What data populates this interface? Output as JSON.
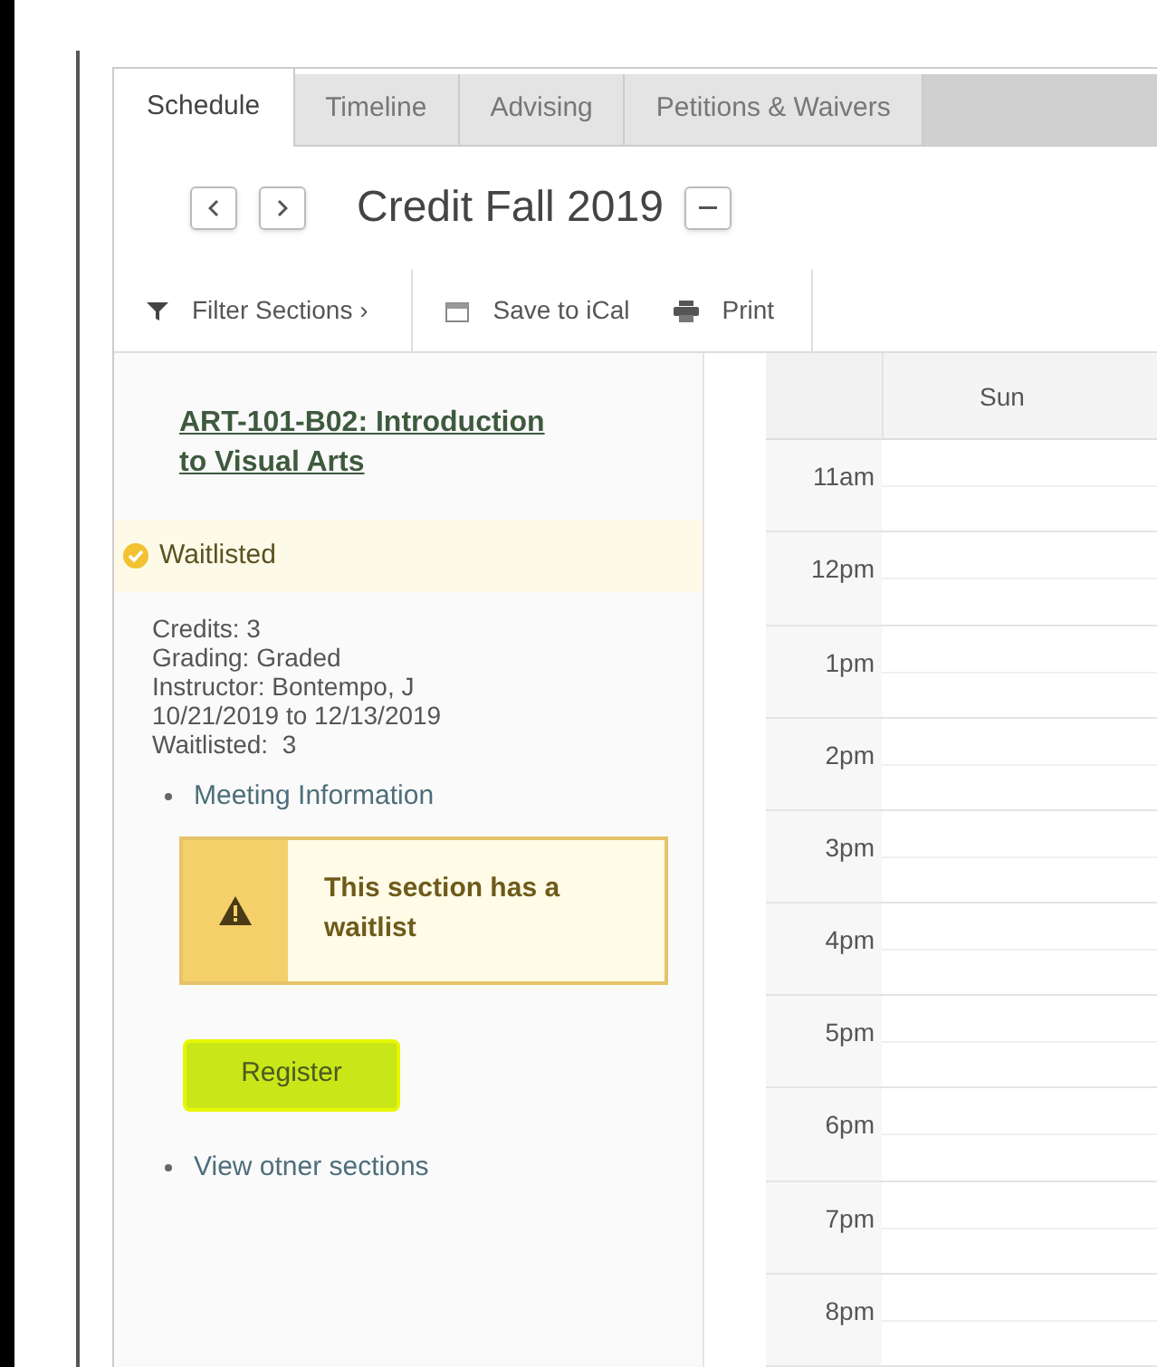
{
  "tabs": [
    {
      "label": "Schedule",
      "selected": true
    },
    {
      "label": "Timeline",
      "selected": false
    },
    {
      "label": "Advising",
      "selected": false
    },
    {
      "label": "Petitions & Waivers",
      "selected": false
    }
  ],
  "term": {
    "title": "Credit Fall 2019"
  },
  "actions": [
    {
      "kind": "filter",
      "label": "Filter Sections ›"
    },
    {
      "kind": "calendar",
      "label": "Save to iCal"
    },
    {
      "kind": "print",
      "label": "Print"
    }
  ],
  "section": {
    "title": "ART-101-B02: Introduction to Visual Arts",
    "status": "Waitlisted",
    "details": [
      "Credits: 3",
      "Grading: Graded",
      "Instructor: Bontempo, J",
      "10/21/2019 to 12/13/2019",
      "Waitlisted:  3"
    ],
    "meeting_link": "Meeting Information",
    "warning": "This section has a waitlist",
    "register": "Register",
    "other_link": "View otner sections"
  },
  "calendar": {
    "day": "Sun",
    "times": [
      "11am",
      "12pm",
      "1pm",
      "2pm",
      "3pm",
      "4pm",
      "5pm",
      "6pm",
      "7pm",
      "8pm"
    ]
  }
}
